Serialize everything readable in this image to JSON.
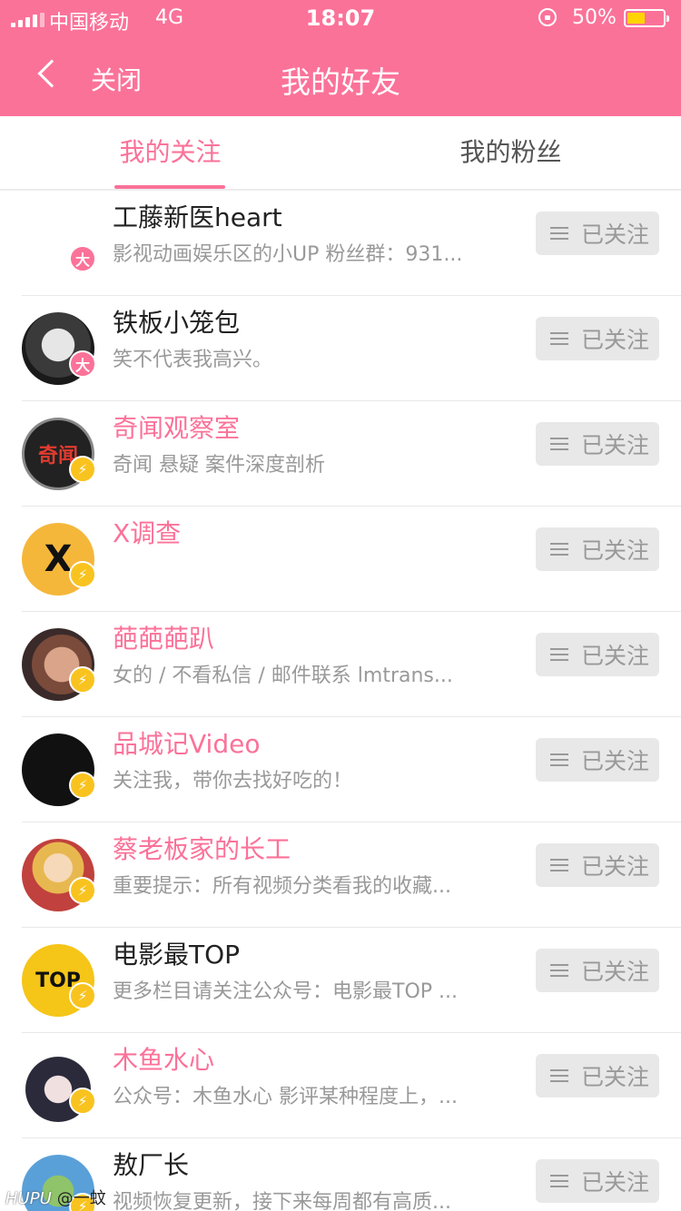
{
  "status_bar": {
    "carrier": "中国移动",
    "network": "4G",
    "time": "18:07",
    "battery_pct": "50%",
    "battery_level": 0.5
  },
  "nav": {
    "back_label": "关闭",
    "title": "我的好友"
  },
  "tabs": [
    {
      "label": "我的关注",
      "active": true
    },
    {
      "label": "我的粉丝",
      "active": false
    }
  ],
  "colors": {
    "accent": "#fb7299",
    "badge_yellow": "#f9c31f",
    "button_bg": "#e8e8e8"
  },
  "follow_label": "已关注",
  "users": [
    {
      "name": "工藤新医heart",
      "desc": "影视动画娱乐区的小UP 粉丝群：931...",
      "name_color": "default",
      "badge": "大",
      "avatar_icon": "calligraphy-avatar"
    },
    {
      "name": "铁板小笼包",
      "desc": "笑不代表我高兴。",
      "name_color": "default",
      "badge": "大",
      "avatar_icon": "joker-face-avatar"
    },
    {
      "name": "奇闻观察室",
      "desc": "奇闻 悬疑 案件深度剖析",
      "name_color": "pink",
      "badge": "⚡",
      "avatar_icon": "qiwen-logo-avatar",
      "avatar_text": "奇闻"
    },
    {
      "name": "X调查",
      "desc": "",
      "name_color": "pink",
      "badge": "⚡",
      "avatar_icon": "x-logo-avatar",
      "avatar_text": "X"
    },
    {
      "name": "葩葩葩趴",
      "desc": "女的 / 不看私信 / 邮件联系 lmtrans...",
      "name_color": "pink",
      "badge": "⚡",
      "avatar_icon": "face-photo-avatar"
    },
    {
      "name": "品城记Video",
      "desc": "关注我，带你去找好吃的！",
      "name_color": "pink",
      "badge": "⚡",
      "avatar_icon": "pinchengji-logo-avatar"
    },
    {
      "name": "蔡老板家的长工",
      "desc": "重要提示：所有视频分类看我的收藏...",
      "name_color": "pink",
      "badge": "⚡",
      "avatar_icon": "anime-boy-avatar"
    },
    {
      "name": "电影最TOP",
      "desc": "更多栏目请关注公众号：电影最TOP ...",
      "name_color": "default",
      "badge": "⚡",
      "avatar_icon": "movie-top-logo-avatar",
      "avatar_text": "TOP"
    },
    {
      "name": "木鱼水心",
      "desc": "公众号：木鱼水心 影评某种程度上，...",
      "name_color": "pink",
      "badge": "⚡",
      "avatar_icon": "anime-character-avatar"
    },
    {
      "name": "敖厂长",
      "desc": "视频恢复更新，接下来每周都有高质...",
      "name_color": "default",
      "badge": "⚡",
      "avatar_icon": "dragon-cartoon-avatar"
    }
  ],
  "watermark": {
    "brand": "HUPU",
    "user": "@一蚊"
  }
}
